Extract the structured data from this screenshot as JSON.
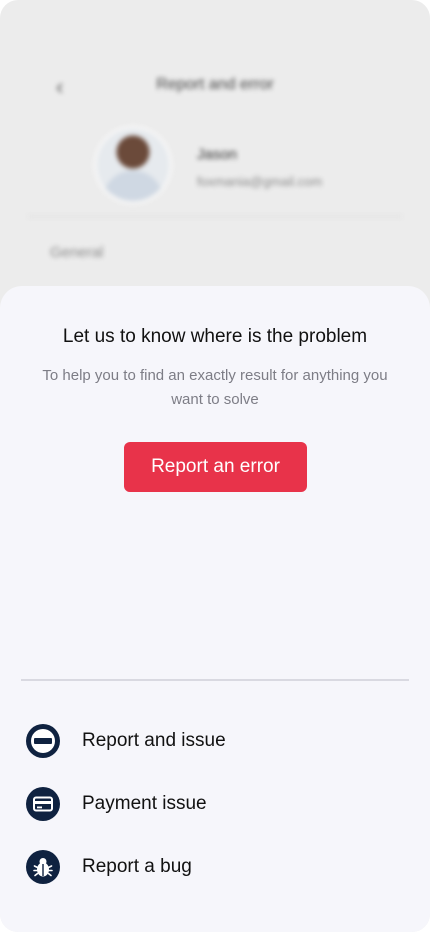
{
  "background": {
    "back_glyph": "‹",
    "title": "Report and error",
    "profile_name": "Jason",
    "profile_email": "foxmania@gmail.com",
    "section_label": "General"
  },
  "sheet": {
    "title": "Let us to know where is the problem",
    "subtitle": "To help you to find an exactly result for anything you want to solve",
    "cta_label": "Report an error",
    "options": [
      {
        "label": "Report and issue",
        "icon": "minus-circle-icon"
      },
      {
        "label": "Payment issue",
        "icon": "card-icon"
      },
      {
        "label": "Report a bug",
        "icon": "bug-icon"
      }
    ]
  },
  "colors": {
    "accent": "#e8334a",
    "icon_bg": "#0f2240",
    "sheet_bg": "#f6f6fb",
    "backdrop": "#ececec"
  }
}
